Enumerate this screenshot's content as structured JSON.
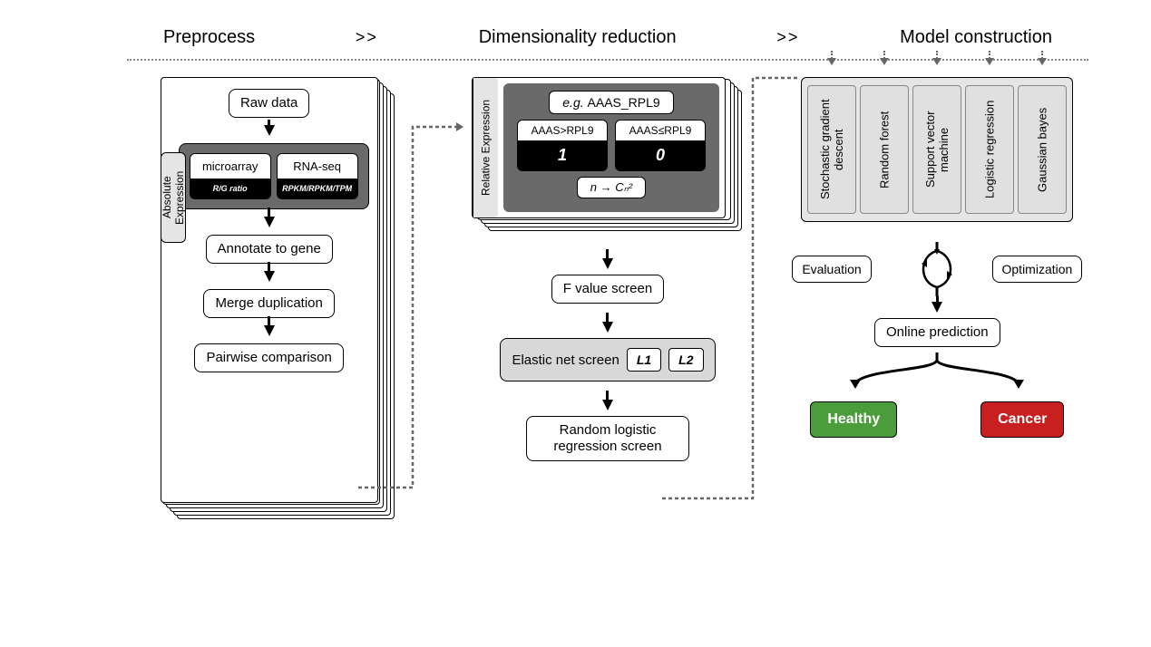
{
  "stages": {
    "preprocess": "Preprocess",
    "dimred": "Dimensionality reduction",
    "model": "Model construction"
  },
  "chev": ">>",
  "col1": {
    "raw": "Raw data",
    "abs_label": "Absolute Expression",
    "microarray": "microarray",
    "microarray_sub": "R/G ratio",
    "rnaseq": "RNA-seq",
    "rnaseq_sub": "RPKM/RPKM/TPM",
    "annotate": "Annotate to gene",
    "merge": "Merge duplication",
    "pairwise": "Pairwise comparison"
  },
  "col2": {
    "rel_label": "Relative Expression",
    "example_prefix": "e.g. ",
    "example": "AAAS_RPL9",
    "pair_gt": "AAAS>RPL9",
    "pair_gt_val": "1",
    "pair_le": "AAAS≤RPL9",
    "pair_le_val": "0",
    "combo": "n → Cₙ²",
    "fvalue": "F value screen",
    "elastic": "Elastic net screen",
    "l1": "L1",
    "l2": "L2",
    "rlr": "Random logistic regression screen"
  },
  "col3": {
    "models": [
      "Stochastic gradient descent",
      "Random forest",
      "Support vector machine",
      "Logistic regression",
      "Gaussian bayes"
    ],
    "evaluation": "Evaluation",
    "optimization": "Optimization",
    "online": "Online prediction",
    "healthy": "Healthy",
    "cancer": "Cancer"
  }
}
